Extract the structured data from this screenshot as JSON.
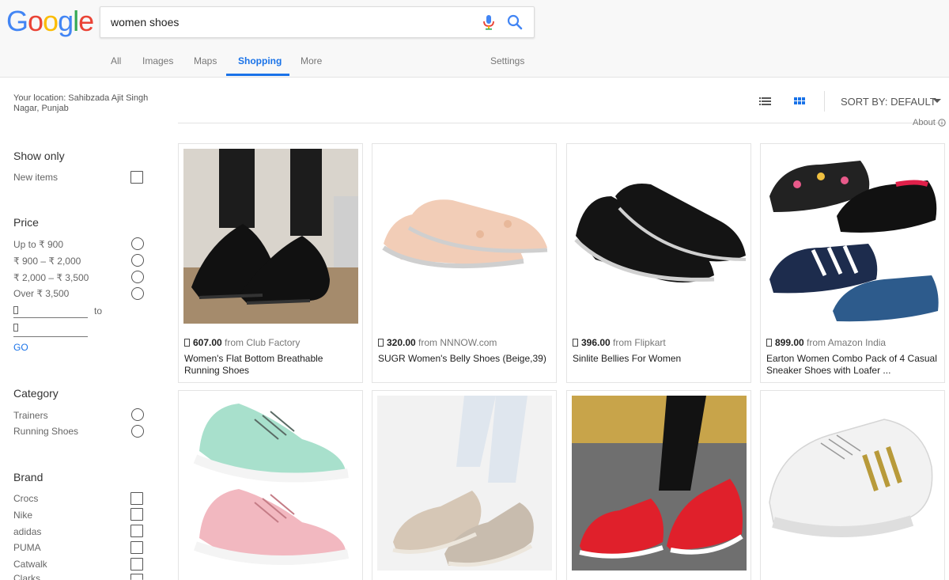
{
  "search": {
    "query": "women shoes"
  },
  "logo": {
    "letters": [
      "G",
      "o",
      "o",
      "g",
      "l",
      "e"
    ],
    "colors": [
      "#4285f4",
      "#ea4335",
      "#fbbc05",
      "#4285f4",
      "#34a853",
      "#ea4335"
    ]
  },
  "nav": {
    "tabs": [
      "All",
      "Images",
      "Maps",
      "Shopping",
      "More"
    ],
    "settings": "Settings",
    "active_color": "#1a73e8"
  },
  "location": "Your location: Sahibzada Ajit Singh Nagar, Punjab",
  "filters": {
    "show_only": {
      "heading": "Show only",
      "items": [
        "New items"
      ]
    },
    "price": {
      "heading": "Price",
      "items": [
        "Up to ₹ 900",
        "₹ 900 – ₹ 2,000",
        "₹ 2,000 – ₹ 3,500",
        "Over ₹ 3,500"
      ],
      "to_label": "to",
      "go_label": "GO"
    },
    "category": {
      "heading": "Category",
      "items": [
        "Trainers",
        "Running Shoes"
      ]
    },
    "brand": {
      "heading": "Brand",
      "items": [
        "Crocs",
        "Nike",
        "adidas",
        "PUMA",
        "Catwalk",
        "Clarks"
      ]
    }
  },
  "toolbar": {
    "list_icon": "list-view-icon",
    "grid_icon": "grid-view-icon",
    "sort_label": "SORT BY: DEFAULT",
    "about": "About"
  },
  "products": [
    {
      "price": "607.00",
      "from": "from Club Factory",
      "title": "Women's Flat Bottom Breathable Running Shoes",
      "shoe_color": "#111111"
    },
    {
      "price": "320.00",
      "from": "from NNNOW.com",
      "title": "SUGR Women's Belly Shoes (Beige,39)",
      "shoe_color": "#f2cdb7"
    },
    {
      "price": "396.00",
      "from": "from Flipkart",
      "title": "Sinlite Bellies For Women",
      "shoe_color": "#141414"
    },
    {
      "price": "899.00",
      "from": "from Amazon India",
      "title": "Earton Women Combo Pack of 4 Casual Sneaker Shoes with Loafer ...",
      "shoe_color": "#1d2c4d"
    },
    {
      "price": "",
      "from": "",
      "title": "",
      "shoe_color": "#a8e0cc"
    },
    {
      "price": "",
      "from": "",
      "title": "",
      "shoe_color": "#d6c7b6"
    },
    {
      "price": "",
      "from": "",
      "title": "",
      "shoe_color": "#e0202b"
    },
    {
      "price": "",
      "from": "",
      "title": "",
      "shoe_color": "#f2f2f2"
    }
  ]
}
